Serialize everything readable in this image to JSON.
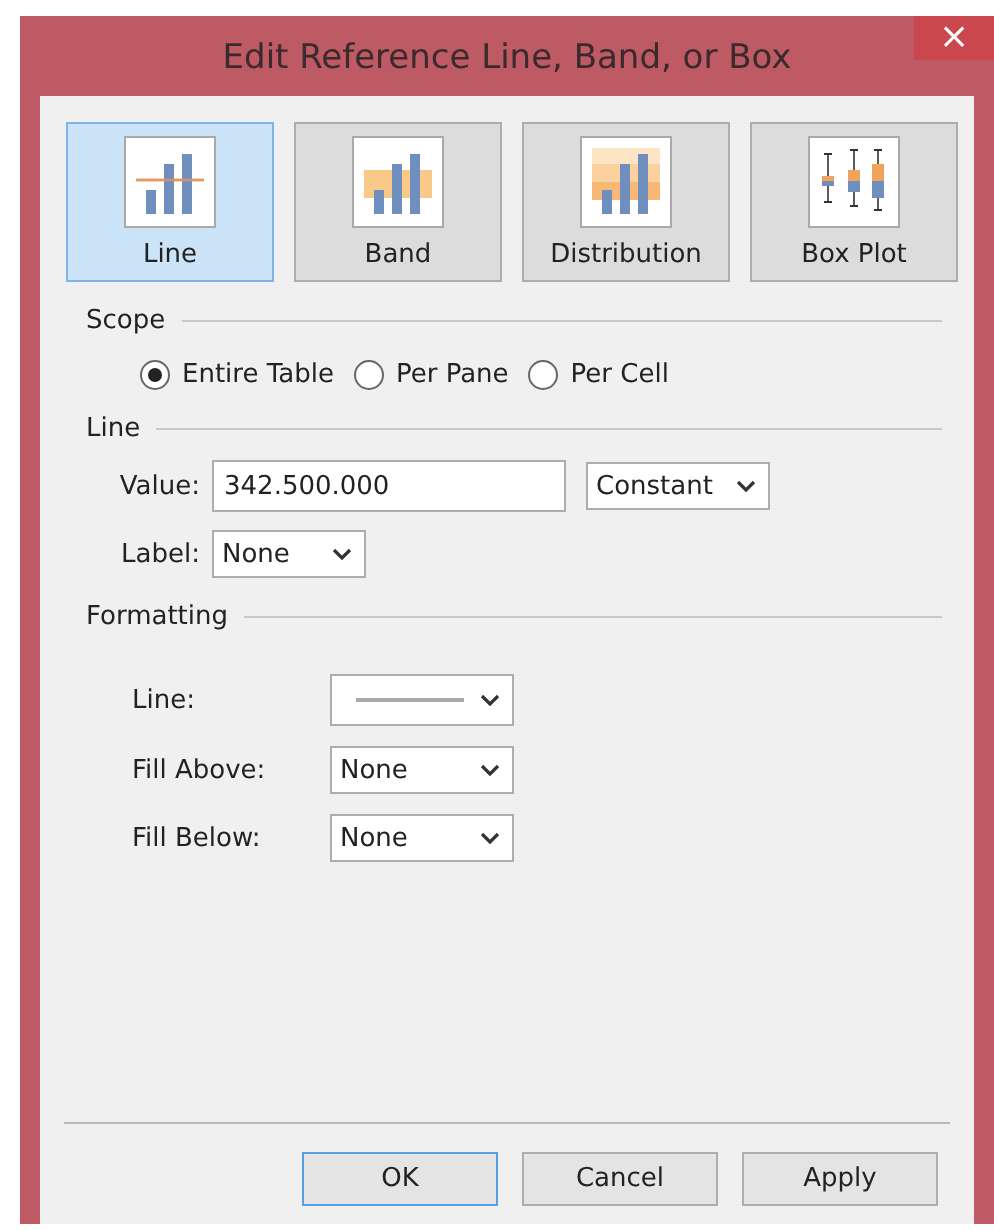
{
  "window": {
    "title": "Edit Reference Line, Band, or Box",
    "close": "×"
  },
  "types": [
    {
      "kind": "line",
      "label": "Line",
      "selected": true
    },
    {
      "kind": "band",
      "label": "Band",
      "selected": false
    },
    {
      "kind": "distribution",
      "label": "Distribution",
      "selected": false
    },
    {
      "kind": "boxplot",
      "label": "Box Plot",
      "selected": false
    }
  ],
  "scope": {
    "heading": "Scope",
    "options": [
      {
        "label": "Entire Table",
        "selected": true
      },
      {
        "label": "Per Pane",
        "selected": false
      },
      {
        "label": "Per Cell",
        "selected": false
      }
    ]
  },
  "line": {
    "heading": "Line",
    "value_label": "Value:",
    "value": "342.500.000",
    "value_type": "Constant",
    "label_label": "Label:",
    "label": "None"
  },
  "formatting": {
    "heading": "Formatting",
    "rows": [
      {
        "kind": "line-style",
        "label": "Line:"
      },
      {
        "kind": "select",
        "label": "Fill Above:",
        "value": "None"
      },
      {
        "kind": "select",
        "label": "Fill Below:",
        "value": "None"
      }
    ]
  },
  "buttons": [
    {
      "label": "OK",
      "default": true
    },
    {
      "label": "Cancel",
      "default": false
    },
    {
      "label": "Apply",
      "default": false
    }
  ]
}
